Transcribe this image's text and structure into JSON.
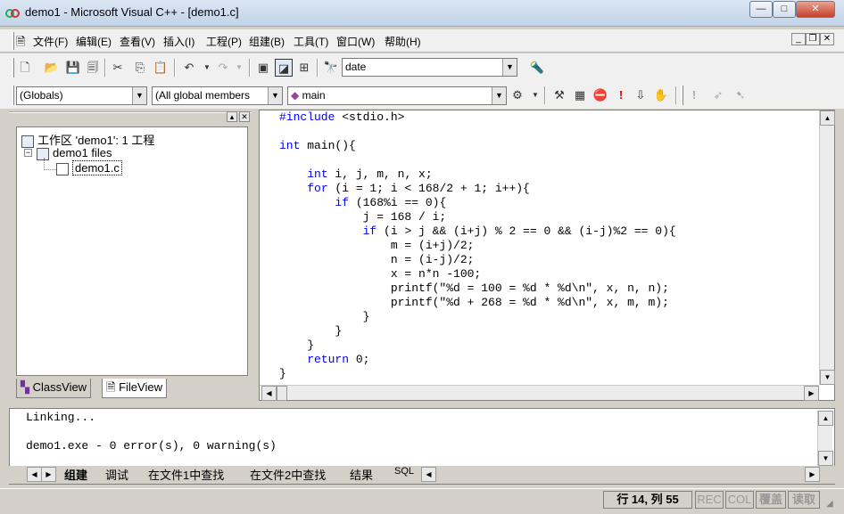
{
  "window": {
    "title": "demo1 - Microsoft Visual C++ - [demo1.c]"
  },
  "menu": {
    "items": [
      "文件(F)",
      "编辑(E)",
      "查看(V)",
      "插入(I)",
      "工程(P)",
      "组建(B)",
      "工具(T)",
      "窗口(W)",
      "帮助(H)"
    ]
  },
  "toolbar": {
    "find_value": "date",
    "globals_combo": "(Globals)",
    "members_combo": "(All global members",
    "function_combo": "main"
  },
  "workspace": {
    "root": "工作区 'demo1': 1 工程",
    "project": "demo1 files",
    "file": "demo1.c",
    "tabs": [
      "ClassView",
      "FileView"
    ]
  },
  "editor": {
    "lines": [
      "#include <stdio.h>",
      "",
      "int main(){",
      "",
      "    int i, j, m, n, x;",
      "    for (i = 1; i < 168/2 + 1; i++){",
      "        if (168%i == 0){",
      "            j = 168 / i;",
      "            if (i > j && (i+j) % 2 == 0 && (i-j)%2 == 0){",
      "                m = (i+j)/2;",
      "                n = (i-j)/2;",
      "                x = n*n -100;",
      "                printf(\"%d = 100 = %d * %d\\n\", x, n, n);",
      "                printf(\"%d + 268 = %d * %d\\n\", x, m, m);",
      "            }",
      "        }",
      "    }",
      "    return 0;",
      "}"
    ]
  },
  "output": {
    "lines": [
      "Linking...",
      "",
      "demo1.exe - 0 error(s), 0 warning(s)"
    ],
    "tabs": [
      "组建",
      "调试",
      "在文件1中查找",
      "在文件2中查找",
      "结果",
      "SQL"
    ]
  },
  "status": {
    "position": "行 14, 列 55",
    "rec": "REC",
    "col": "COL",
    "ovr": "覆盖",
    "read": "读取"
  },
  "colors": {
    "keyword": "#0000ff",
    "title_bar": "#c2d3e8"
  }
}
